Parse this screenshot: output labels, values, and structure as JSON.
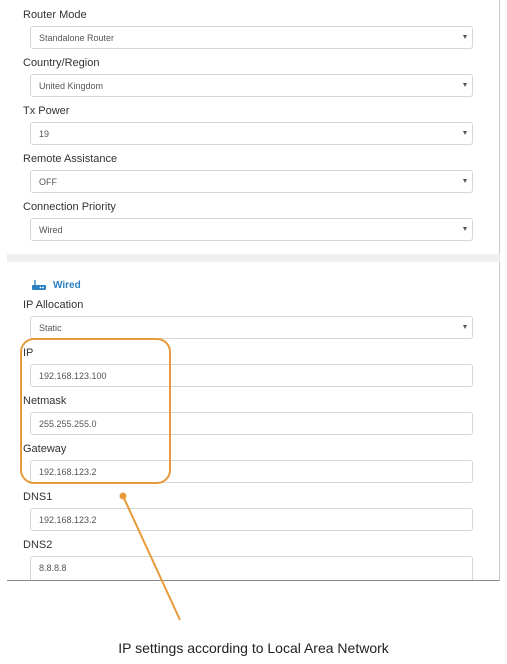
{
  "settings": {
    "router_mode": {
      "label": "Router Mode",
      "value": "Standalone Router"
    },
    "country_region": {
      "label": "Country/Region",
      "value": "United Kingdom"
    },
    "tx_power": {
      "label": "Tx Power",
      "value": "19"
    },
    "remote_assistance": {
      "label": "Remote Assistance",
      "value": "OFF"
    },
    "connection_priority": {
      "label": "Connection Priority",
      "value": "Wired"
    }
  },
  "wired": {
    "section_title": "Wired",
    "icon": "router-icon",
    "ip_allocation": {
      "label": "IP Allocation",
      "value": "Static"
    },
    "ip": {
      "label": "IP",
      "value": "192.168.123.100"
    },
    "netmask": {
      "label": "Netmask",
      "value": "255.255.255.0"
    },
    "gateway": {
      "label": "Gateway",
      "value": "192.168.123.2"
    },
    "dns1": {
      "label": "DNS1",
      "value": "192.168.123.2"
    },
    "dns2": {
      "label": "DNS2",
      "value": "8.8.8.8"
    }
  },
  "annotation": {
    "caption": "IP settings according to Local Area Network",
    "highlight_color": "#e79a3a"
  },
  "colors": {
    "accent": "#2a7fc1",
    "highlight": "#e79a3a"
  }
}
